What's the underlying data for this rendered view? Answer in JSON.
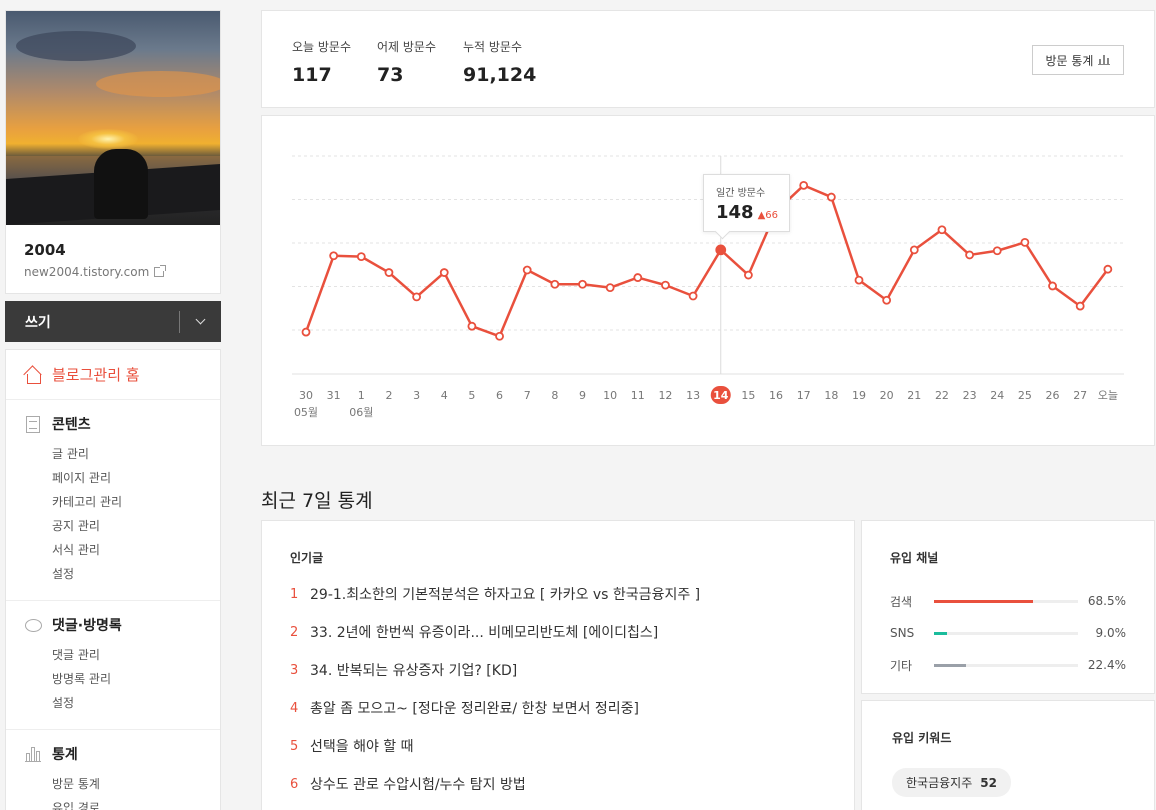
{
  "profile": {
    "name": "2004",
    "url": "new2004.tistory.com"
  },
  "write": {
    "label": "쓰기"
  },
  "menu": {
    "home": "블로그관리 홈",
    "sections": [
      {
        "title": "콘텐츠",
        "icon": "document-icon",
        "items": [
          "글 관리",
          "페이지 관리",
          "카테고리 관리",
          "공지 관리",
          "서식 관리",
          "설정"
        ]
      },
      {
        "title": "댓글·방명록",
        "icon": "comment-icon",
        "items": [
          "댓글 관리",
          "방명록 관리",
          "설정"
        ]
      },
      {
        "title": "통계",
        "icon": "bar-chart-icon",
        "items": [
          "방문 통계",
          "유입 경로"
        ]
      }
    ]
  },
  "stats": {
    "today": {
      "label": "오늘 방문수",
      "value": "117"
    },
    "yesterday": {
      "label": "어제 방문수",
      "value": "73"
    },
    "total": {
      "label": "누적 방문수",
      "value": "91,124"
    },
    "button": "방문 통계"
  },
  "tooltip": {
    "label": "일간 방문수",
    "value": "148",
    "delta": "66"
  },
  "chart_data": {
    "type": "line",
    "x": [
      "30",
      "31",
      "1",
      "2",
      "3",
      "4",
      "5",
      "6",
      "7",
      "8",
      "9",
      "10",
      "11",
      "12",
      "13",
      "14",
      "15",
      "16",
      "17",
      "18",
      "19",
      "20",
      "21",
      "22",
      "23",
      "24",
      "25",
      "26",
      "27",
      "오늘"
    ],
    "month_labels": [
      {
        "index": 0,
        "label": "05월"
      },
      {
        "index": 2,
        "label": "06월"
      }
    ],
    "values": [
      50,
      141,
      140,
      121,
      92,
      121,
      57,
      45,
      124,
      107,
      107,
      103,
      115,
      106,
      93,
      148,
      118,
      194,
      225,
      211,
      112,
      88,
      148,
      172,
      142,
      147,
      157,
      105,
      81,
      125
    ],
    "highlight_index": 15,
    "ylim": [
      0,
      260
    ],
    "grid": true,
    "color": "#e9503d"
  },
  "recent": {
    "title": "최근 7일 통계",
    "popular": {
      "title": "인기글",
      "items": [
        {
          "rank": "1",
          "title": "29-1.최소한의 기본적분석은 하자고요 [ 카카오 vs 한국금융지주 ]"
        },
        {
          "rank": "2",
          "title": "33. 2년에 한번씩 유증이라... 비메모리반도체 [에이디칩스]"
        },
        {
          "rank": "3",
          "title": "34. 반복되는 유상증자 기업? [KD]"
        },
        {
          "rank": "4",
          "title": "총알 좀 모으고~ [정다운 정리완료/ 한창 보면서 정리중]"
        },
        {
          "rank": "5",
          "title": "선택을 해야 할 때"
        },
        {
          "rank": "6",
          "title": "상수도 관로 수압시험/누수 탐지 방법"
        }
      ]
    },
    "channels": {
      "title": "유입 채널",
      "items": [
        {
          "name": "검색",
          "pct": "68.5%",
          "value": 68.5,
          "color": "#e9503d"
        },
        {
          "name": "SNS",
          "pct": "9.0%",
          "value": 9.0,
          "color": "#1abc9c"
        },
        {
          "name": "기타",
          "pct": "22.4%",
          "value": 22.4,
          "color": "#9aa0a8"
        }
      ]
    },
    "keywords": {
      "title": "유입 키워드",
      "items": [
        {
          "keyword": "한국금융지주",
          "count": "52"
        }
      ]
    }
  }
}
